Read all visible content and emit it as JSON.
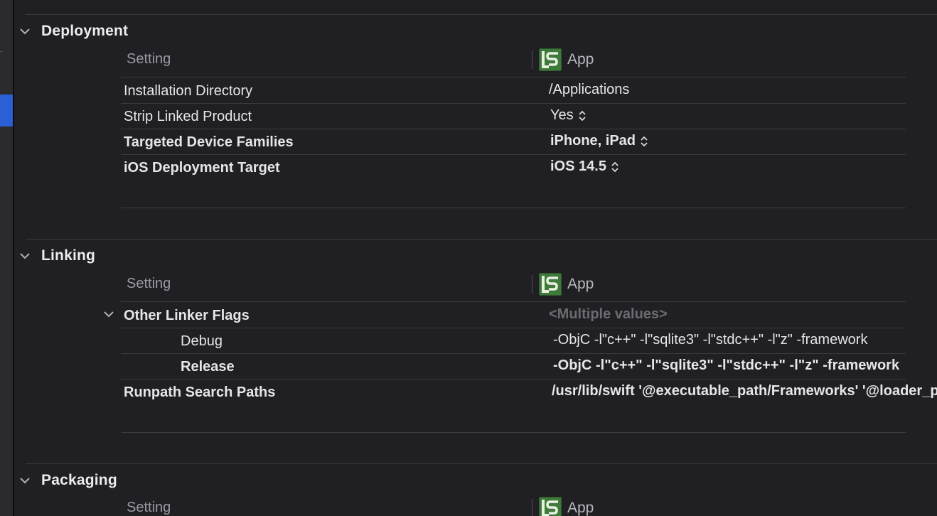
{
  "columns": {
    "setting_label": "Setting",
    "target_label": "App"
  },
  "sections": [
    {
      "title": "Deployment",
      "rows": [
        {
          "name": "Installation Directory",
          "value": "/Applications",
          "bold": false,
          "stepper": false
        },
        {
          "name": "Strip Linked Product",
          "value": "Yes",
          "bold": false,
          "stepper": true
        },
        {
          "name": "Targeted Device Families",
          "value": "iPhone, iPad",
          "bold": true,
          "stepper": true
        },
        {
          "name": "iOS Deployment Target",
          "value": "iOS 14.5",
          "bold": true,
          "stepper": true
        }
      ]
    },
    {
      "title": "Linking",
      "rows": [
        {
          "name": "Other Linker Flags",
          "value": "<Multiple values>",
          "bold": true,
          "muted": true
        },
        {
          "name": "Debug",
          "value": "-ObjC -l\"c++\" -l\"sqlite3\" -l\"stdc++\" -l\"z\" -framework",
          "bold": false
        },
        {
          "name": "Release",
          "value": "-ObjC -l\"c++\" -l\"sqlite3\" -l\"stdc++\" -l\"z\" -framework",
          "bold": true
        },
        {
          "name": "Runpath Search Paths",
          "value": "/usr/lib/swift '@executable_path/Frameworks' '@loader_path/Frameworks'",
          "bold": true
        }
      ]
    },
    {
      "title": "Packaging"
    }
  ],
  "colors": {
    "background": "#1f1f24",
    "sidebar_selection": "#2c5fd6",
    "app_icon": "#3f7a3a"
  },
  "icons": {
    "section_toggle": "chevron-down-icon",
    "value_stepper": "up-down-chevron-icon",
    "target_icon": "app-target-icon"
  }
}
